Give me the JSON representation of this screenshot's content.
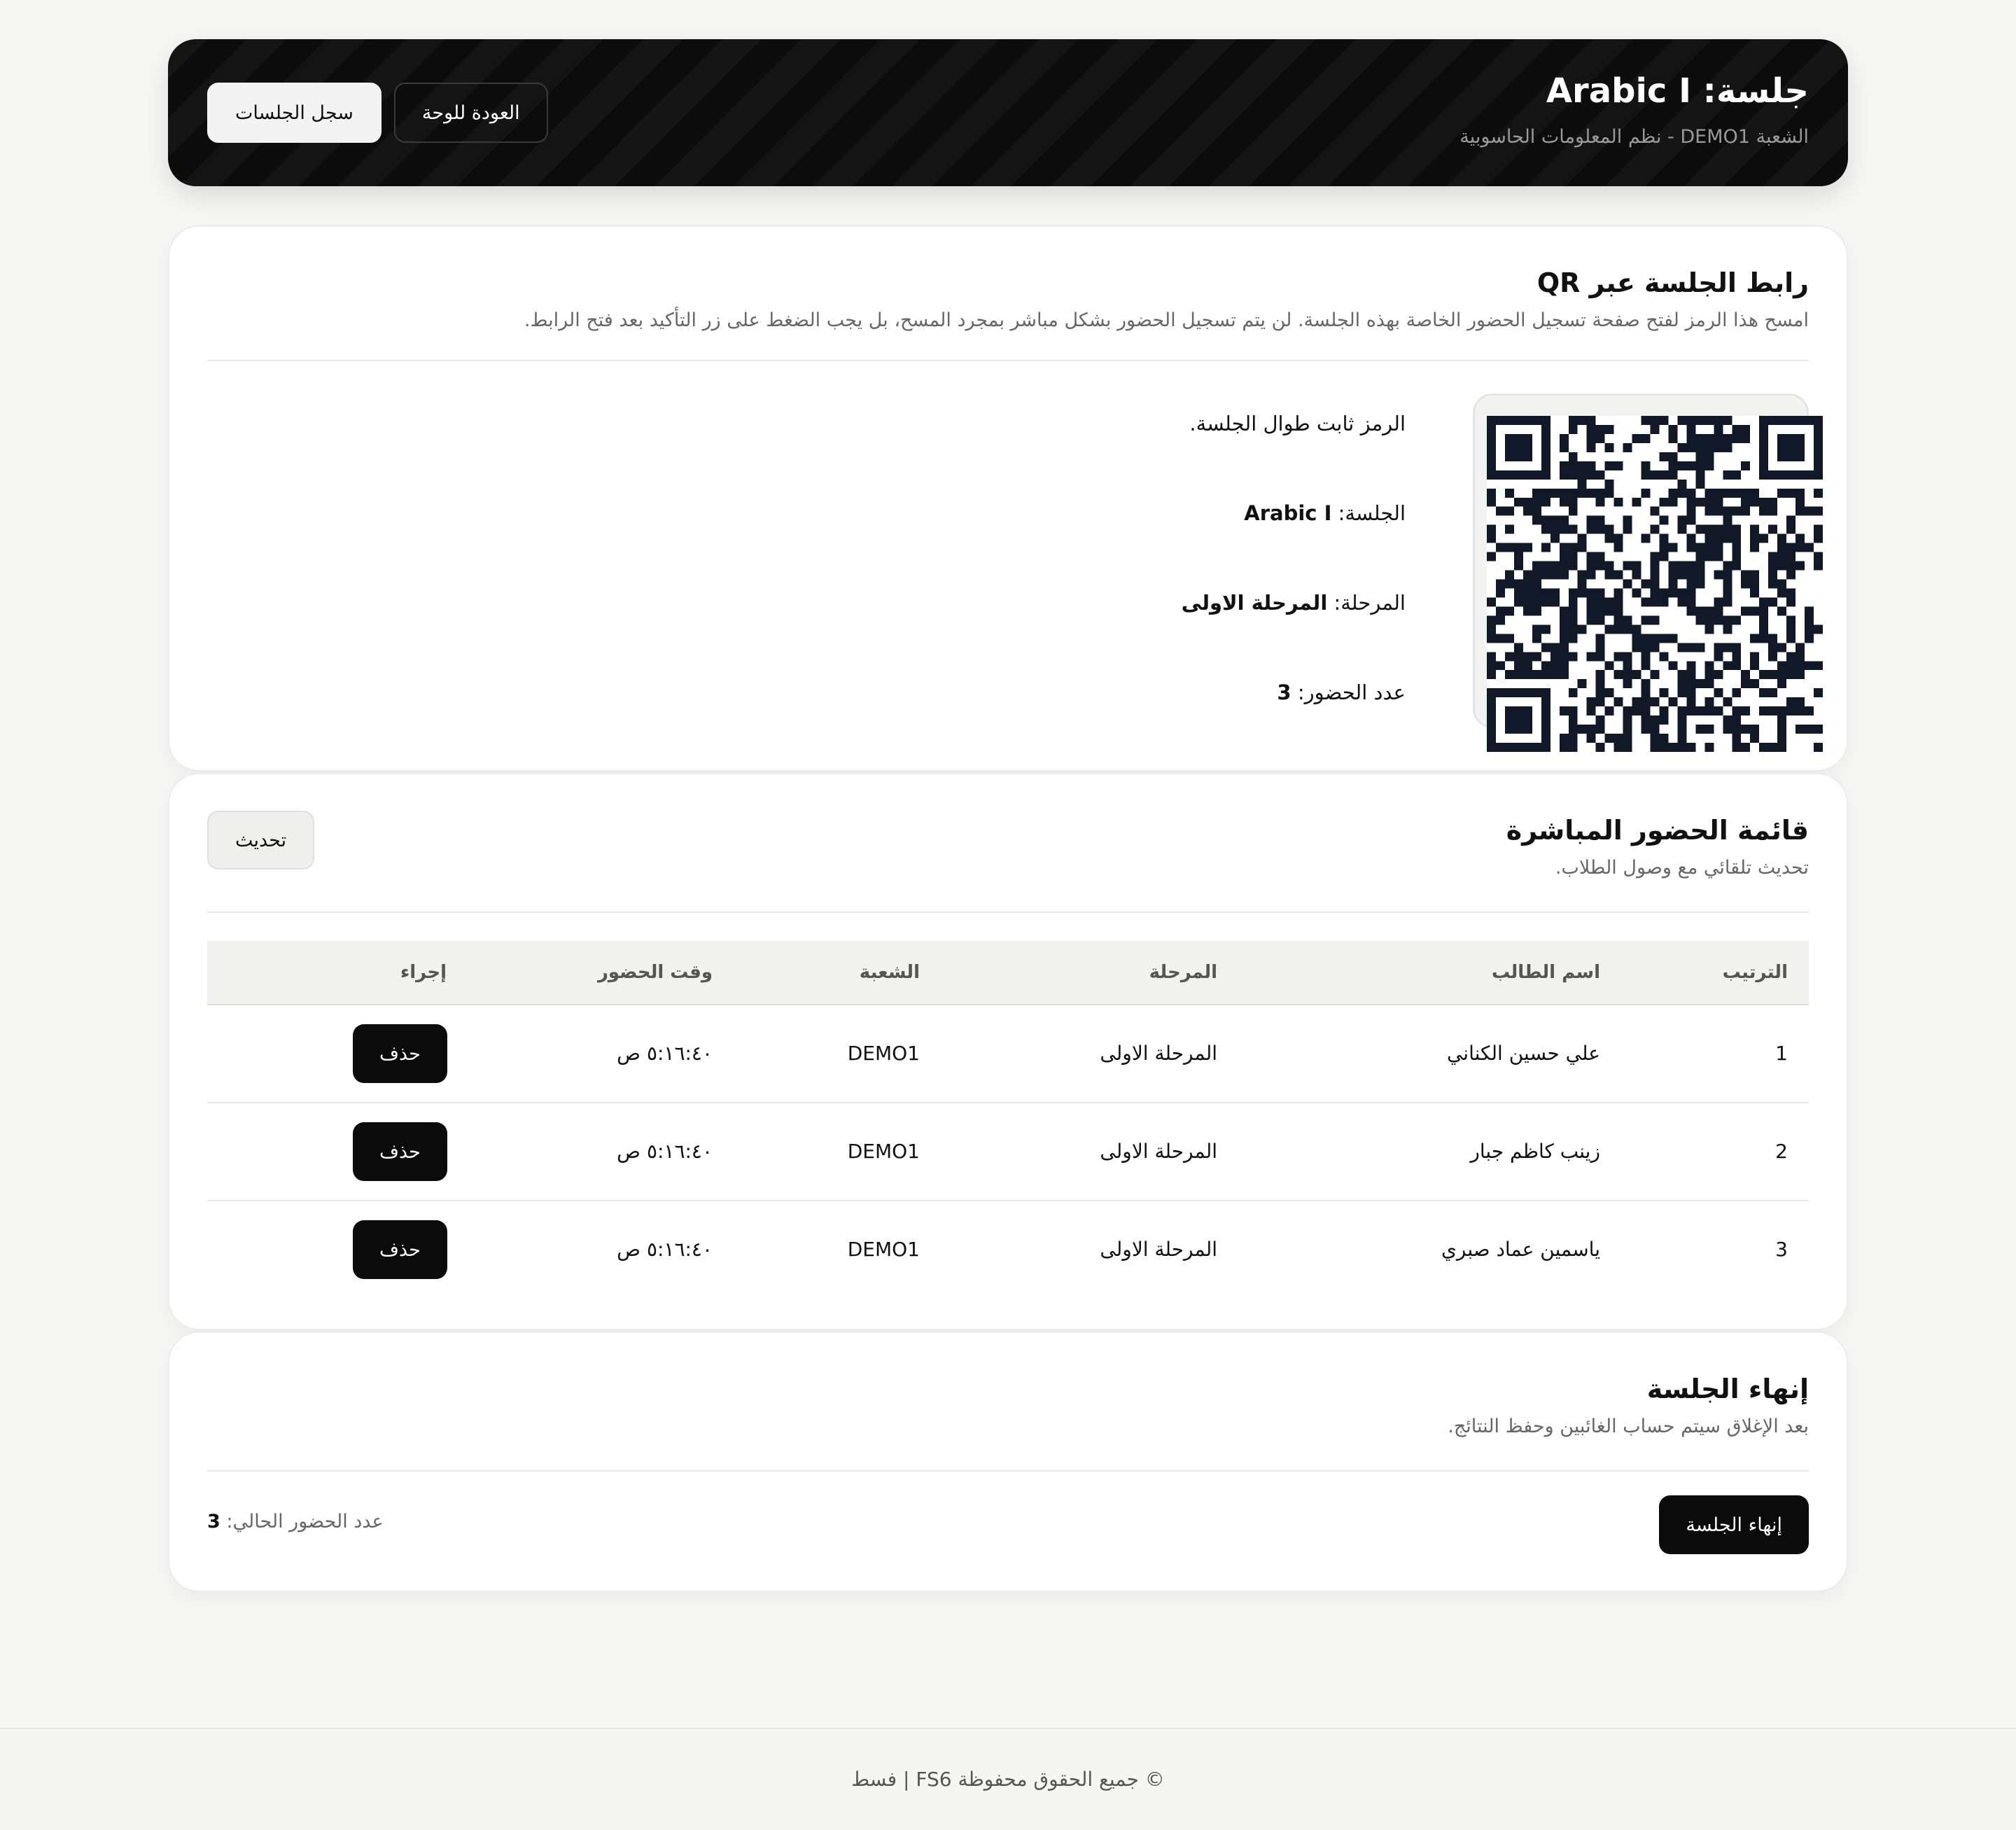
{
  "header": {
    "title": "جلسة: Arabic I",
    "subtitle": "الشعبة DEMO1 - نظم المعلومات الحاسوبية",
    "sessions_log_label": "سجل الجلسات",
    "back_label": "العودة للوحة"
  },
  "qr_card": {
    "title": "رابط الجلسة عبر QR",
    "description": "امسح هذا الرمز لفتح صفحة تسجيل الحضور الخاصة بهذه الجلسة. لن يتم تسجيل الحضور بشكل مباشر بمجرد المسح، بل يجب الضغط على زر التأكيد بعد فتح الرابط.",
    "static_note": "الرمز ثابت طوال الجلسة.",
    "session_label": "الجلسة:",
    "session_value": "Arabic I",
    "stage_label": "المرحلة:",
    "stage_value": "المرحلة الاولى",
    "count_label": "عدد الحضور:",
    "count_value": "3"
  },
  "attendance": {
    "title": "قائمة الحضور المباشرة",
    "subtitle": "تحديث تلقائي مع وصول الطلاب.",
    "refresh_label": "تحديث",
    "columns": {
      "rank": "الترتيب",
      "name": "اسم الطالب",
      "stage": "المرحلة",
      "section": "الشعبة",
      "time": "وقت الحضور",
      "action": "إجراء"
    },
    "rows": [
      {
        "rank": "1",
        "name": "علي حسين الكناني",
        "stage": "المرحلة الاولى",
        "section": "DEMO1",
        "time": "٥:١٦:٤٠ ص",
        "action": "حذف"
      },
      {
        "rank": "2",
        "name": "زينب كاظم جبار",
        "stage": "المرحلة الاولى",
        "section": "DEMO1",
        "time": "٥:١٦:٤٠ ص",
        "action": "حذف"
      },
      {
        "rank": "3",
        "name": "ياسمين عماد صبري",
        "stage": "المرحلة الاولى",
        "section": "DEMO1",
        "time": "٥:١٦:٤٠ ص",
        "action": "حذف"
      }
    ]
  },
  "end_session": {
    "title": "إنهاء الجلسة",
    "subtitle": "بعد الإغلاق سيتم حساب الغائبين وحفظ النتائج.",
    "button_label": "إنهاء الجلسة",
    "count_label": "عدد الحضور الحالي:",
    "count_value": "3"
  },
  "footer": {
    "text": "© جميع الحقوق محفوظة FS6 | فسط"
  }
}
